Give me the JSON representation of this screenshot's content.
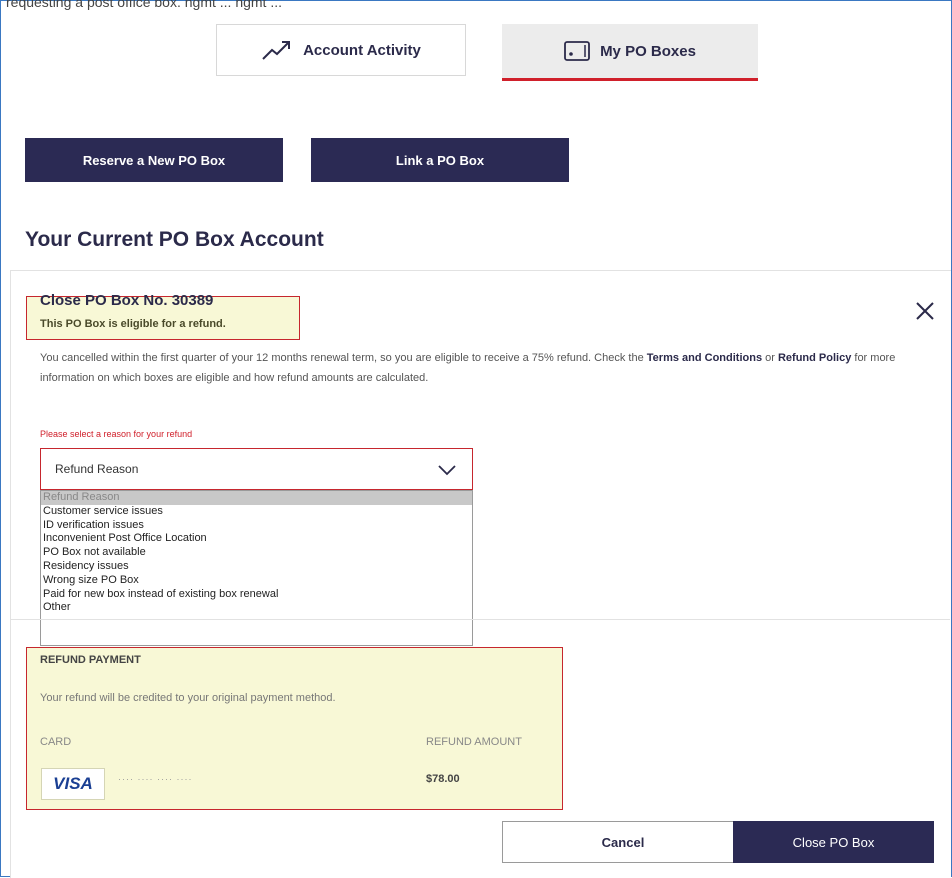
{
  "top_caption": "requesting a post office box. ngmt ... ngmt ...",
  "tabs": [
    {
      "label": "Account Activity",
      "icon": "trending-up-icon"
    },
    {
      "label": "My PO Boxes",
      "icon": "po-box-icon",
      "active": true
    }
  ],
  "actions": {
    "reserve_label": "Reserve a New PO Box",
    "link_label": "Link a PO Box"
  },
  "section_title": "Your Current PO Box Account",
  "close_panel": {
    "title": "Close PO Box No. 30389",
    "eligible_message": "This PO Box is eligible for a refund.",
    "paragraph": {
      "text1": "You cancelled within the first quarter of your 12 months renewal term, so you are eligible to receive a 75% refund. Check the ",
      "terms_link": "Terms and Conditions",
      "text2": " or ",
      "refund_link": "Refund Policy",
      "text3": " for more information on which boxes are eligible and how refund amounts are calculated."
    },
    "reason_label": "Please select a reason for your refund",
    "select_value": "Refund Reason",
    "options": [
      "Refund Reason",
      "Customer service issues",
      "ID verification issues",
      "Inconvenient Post Office Location",
      "PO Box not available",
      "Residency issues",
      "Wrong size PO Box",
      "Paid for new box instead of existing box renewal",
      "Other"
    ]
  },
  "refund_payment": {
    "heading": "REFUND PAYMENT",
    "note": "Your refund will be credited to your original payment method.",
    "card_label": "CARD",
    "amount_label": "REFUND AMOUNT",
    "card_brand": "VISA",
    "card_mask": "···· ···· ···· ····",
    "amount": "$78.00"
  },
  "footer": {
    "cancel_label": "Cancel",
    "close_label": "Close PO Box"
  },
  "colors": {
    "navy": "#2b2a54",
    "accent_red": "#d0202b",
    "highlight": "#f8f8d6"
  }
}
